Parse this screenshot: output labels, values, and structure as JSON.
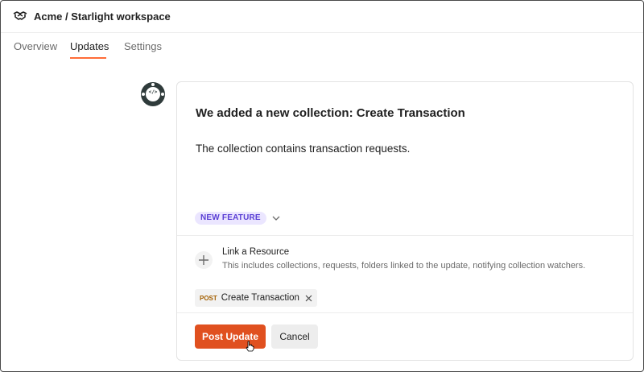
{
  "header": {
    "workspace_title": "Acme / Starlight workspace",
    "workspace_icon": "handshake-icon"
  },
  "tabs": [
    {
      "label": "Overview",
      "active": false
    },
    {
      "label": "Updates",
      "active": true
    },
    {
      "label": "Settings",
      "active": false
    }
  ],
  "update": {
    "avatar_icon": "code-robot-avatar",
    "avatar_text": "</>",
    "title": "We added a new collection: Create Transaction",
    "body": "The collection contains transaction requests.",
    "badge": "NEW FEATURE",
    "badge_color": "#5a3fd4"
  },
  "resource": {
    "title": "Link a Resource",
    "description": "This includes collections, requests, folders linked to the update, notifying collection watchers.",
    "linked": [
      {
        "method": "POST",
        "name": "Create Transaction"
      }
    ]
  },
  "actions": {
    "post_label": "Post Update",
    "cancel_label": "Cancel"
  },
  "colors": {
    "accent": "#ff6c37",
    "primary_button": "#e0501f",
    "method_post": "#a35f00"
  }
}
